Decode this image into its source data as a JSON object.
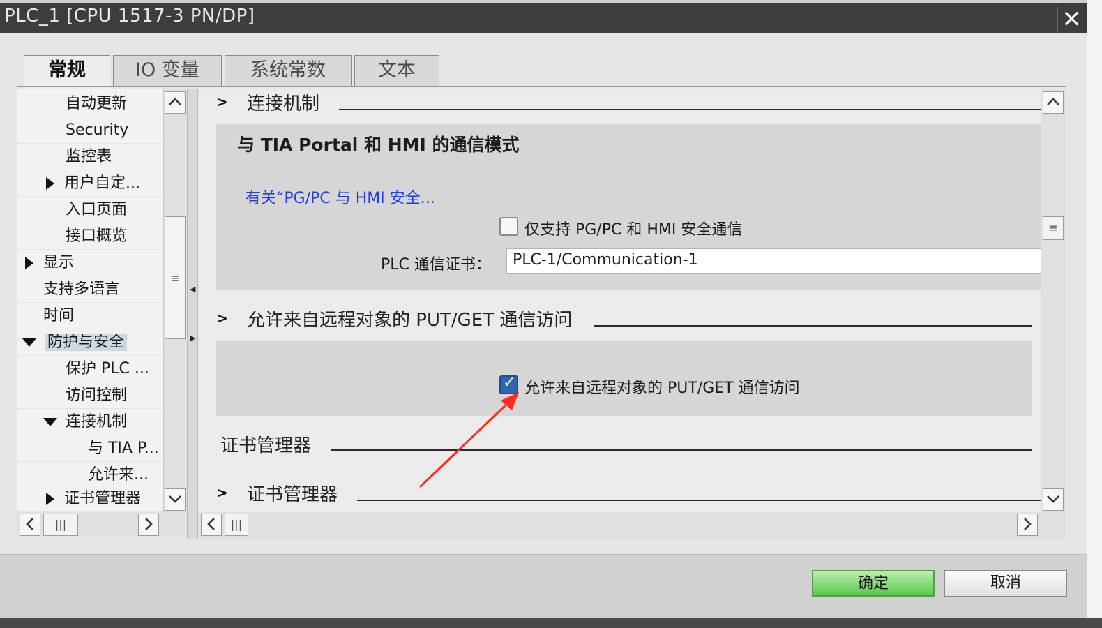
{
  "window": {
    "title": "PLC_1 [CPU 1517-3 PN/DP]",
    "close_glyph": "✕"
  },
  "tabs": [
    {
      "label": "常规",
      "active": true
    },
    {
      "label": "IO 变量",
      "active": false
    },
    {
      "label": "系统常数",
      "active": false
    },
    {
      "label": "文本",
      "active": false
    }
  ],
  "nav": {
    "items": [
      {
        "label": "自动更新"
      },
      {
        "label": "Security"
      },
      {
        "label": "监控表"
      },
      {
        "label": "用户自定..."
      },
      {
        "label": "入口页面"
      },
      {
        "label": "接口概览"
      },
      {
        "label": "显示"
      },
      {
        "label": "支持多语言"
      },
      {
        "label": "时间"
      },
      {
        "label": "防护与安全"
      },
      {
        "label": "保护 PLC ..."
      },
      {
        "label": "访问控制"
      },
      {
        "label": "连接机制"
      },
      {
        "label": "与 TIA P..."
      },
      {
        "label": "允许来..."
      },
      {
        "label": "证书管理器"
      }
    ]
  },
  "scroll": {
    "up": "^",
    "down": "v",
    "left": "<",
    "right": ">",
    "grip": "≡",
    "hgrip": "|||"
  },
  "content": {
    "connection_header": "连接机制",
    "tia_section": {
      "title": "与 TIA Portal 和 HMI 的通信模式",
      "link": "有关“PG/PC 与 HMI 安全...",
      "checkbox_label": "仅支持 PG/PC 和 HMI 安全通信",
      "checkbox_checked": false,
      "cert_label": "PLC 通信证书：",
      "cert_value": "PLC-1/Communication-1"
    },
    "putget_header": "允许来自远程对象的 PUT/GET 通信访问",
    "putget_checkbox_label": "允许来自远程对象的 PUT/GET 通信访问",
    "putget_checked": true,
    "cert_manager_title": "证书管理器",
    "cert_manager_header": "证书管理器"
  },
  "footer": {
    "ok": "确定",
    "cancel": "取消"
  },
  "colors": {
    "annotation_arrow": "#ff2a1a",
    "checkbox_on": "#2f66b0",
    "link": "#1f3fe0"
  }
}
